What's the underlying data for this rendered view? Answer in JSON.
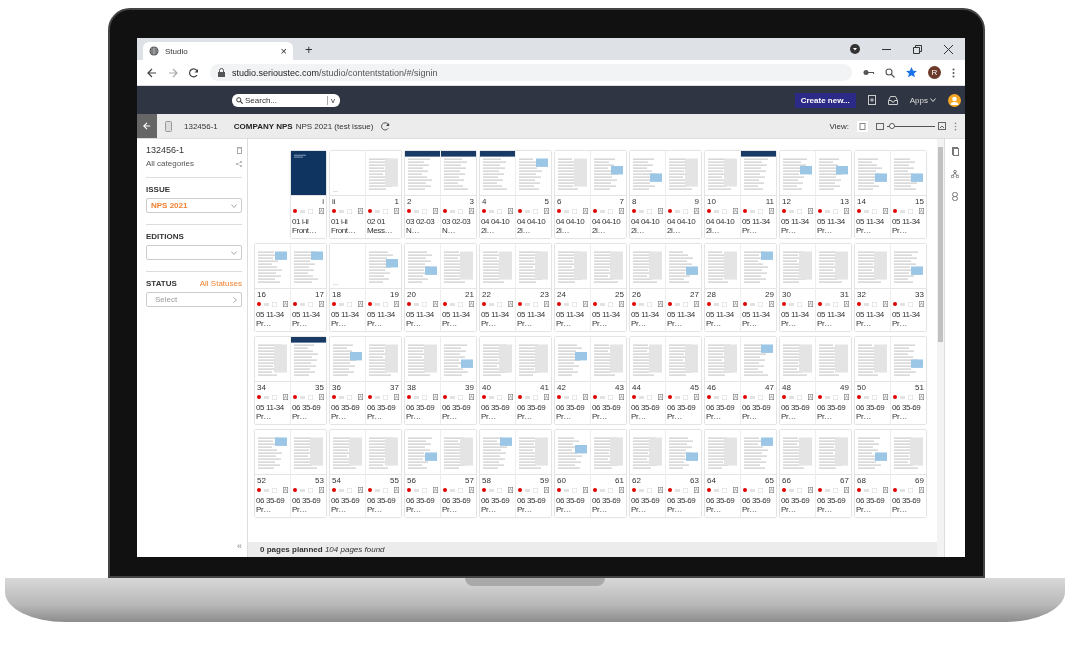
{
  "browser": {
    "tab": {
      "title": "Studio",
      "close": "×"
    },
    "new_tab": "+",
    "url_host": "studio.serioustec.com",
    "url_path": "/studio/contentstation/#/signin",
    "profile_initial": "R"
  },
  "header": {
    "search": {
      "placeholder": "Search...",
      "caret": "v"
    },
    "create_button": "Create new...",
    "apps_menu": "Apps"
  },
  "toolbar": {
    "id": "132456-1",
    "brand": "COMPANY NPS",
    "issue": "NPS 2021 (test issue)",
    "view_label": "View:",
    "zoom": {
      "level": 0.05
    }
  },
  "sidebar": {
    "title": "132456-1",
    "categories": "All categories",
    "issue_label": "ISSUE",
    "issue_value": "NPS 2021",
    "editions_label": "EDITIONS",
    "status_label": "STATUS",
    "status_link": "All Statuses",
    "status_select": {
      "placeholder": "Select"
    },
    "collapse": "«"
  },
  "spreads": [
    {
      "pages": [
        {
          "number": "i",
          "label": "01 i-ii Front…",
          "kind": "cover"
        }
      ]
    },
    {
      "pages": [
        {
          "number": "ii",
          "label": "01 i-ii Front…",
          "kind": "blank"
        },
        {
          "number": "1",
          "label": "02 01 Mess…",
          "kind": "text"
        }
      ]
    },
    {
      "pages": [
        {
          "number": "2",
          "label": "03 02-03 N…",
          "kind": "header"
        },
        {
          "number": "3",
          "label": "03 02-03 N…",
          "kind": "header"
        }
      ]
    },
    {
      "pages": [
        {
          "number": "4",
          "label": "04 04-10 2l…",
          "kind": "header"
        },
        {
          "number": "5",
          "label": "04 04-10 2l…",
          "kind": "figure"
        }
      ]
    },
    {
      "pages": [
        {
          "number": "6",
          "label": "04 04-10 2l…",
          "kind": "text"
        },
        {
          "number": "7",
          "label": "04 04-10 2l…",
          "kind": "figure"
        }
      ]
    },
    {
      "pages": [
        {
          "number": "8",
          "label": "04 04-10 2l…",
          "kind": "figure"
        },
        {
          "number": "9",
          "label": "04 04-10 2l…",
          "kind": "text"
        }
      ]
    },
    {
      "pages": [
        {
          "number": "10",
          "label": "04 04-10 2l…",
          "kind": "text"
        },
        {
          "number": "11",
          "label": "05 11-34 Pr…",
          "kind": "header"
        }
      ]
    },
    {
      "pages": [
        {
          "number": "12",
          "label": "05 11-34 Pr…",
          "kind": "figure"
        },
        {
          "number": "13",
          "label": "05 11-34 Pr…",
          "kind": "figure"
        }
      ]
    },
    {
      "pages": [
        {
          "number": "14",
          "label": "05 11-34 Pr…",
          "kind": "figure"
        },
        {
          "number": "15",
          "label": "05 11-34 Pr…",
          "kind": "figure"
        }
      ]
    },
    {
      "pages": [
        {
          "number": "16",
          "label": "05 11-34 Pr…",
          "kind": "figure"
        },
        {
          "number": "17",
          "label": "05 11-34 Pr…",
          "kind": "figure"
        }
      ]
    },
    {
      "pages": [
        {
          "number": "18",
          "label": "05 11-34 Pr…",
          "kind": "blank"
        },
        {
          "number": "19",
          "label": "05 11-34 Pr…",
          "kind": "figure"
        }
      ]
    },
    {
      "pages": [
        {
          "number": "20",
          "label": "05 11-34 Pr…",
          "kind": "figure"
        },
        {
          "number": "21",
          "label": "05 11-34 Pr…",
          "kind": "text"
        }
      ]
    },
    {
      "pages": [
        {
          "number": "22",
          "label": "05 11-34 Pr…",
          "kind": "text"
        },
        {
          "number": "23",
          "label": "05 11-34 Pr…",
          "kind": "text"
        }
      ]
    },
    {
      "pages": [
        {
          "number": "24",
          "label": "05 11-34 Pr…",
          "kind": "text"
        },
        {
          "number": "25",
          "label": "05 11-34 Pr…",
          "kind": "text"
        }
      ]
    },
    {
      "pages": [
        {
          "number": "26",
          "label": "05 11-34 Pr…",
          "kind": "text"
        },
        {
          "number": "27",
          "label": "05 11-34 Pr…",
          "kind": "figure"
        }
      ]
    },
    {
      "pages": [
        {
          "number": "28",
          "label": "05 11-34 Pr…",
          "kind": "text"
        },
        {
          "number": "29",
          "label": "05 11-34 Pr…",
          "kind": "figure"
        }
      ]
    },
    {
      "pages": [
        {
          "number": "30",
          "label": "05 11-34 Pr…",
          "kind": "text"
        },
        {
          "number": "31",
          "label": "05 11-34 Pr…",
          "kind": "text"
        }
      ]
    },
    {
      "pages": [
        {
          "number": "32",
          "label": "05 11-34 Pr…",
          "kind": "text"
        },
        {
          "number": "33",
          "label": "05 11-34 Pr…",
          "kind": "figure"
        }
      ]
    },
    {
      "pages": [
        {
          "number": "34",
          "label": "05 11-34 Pr…",
          "kind": "text"
        },
        {
          "number": "35",
          "label": "06 35-69 Pr…",
          "kind": "header"
        }
      ]
    },
    {
      "pages": [
        {
          "number": "36",
          "label": "06 35-69 Pr…",
          "kind": "figure"
        },
        {
          "number": "37",
          "label": "06 35-69 Pr…",
          "kind": "text"
        }
      ]
    },
    {
      "pages": [
        {
          "number": "38",
          "label": "06 35-69 Pr…",
          "kind": "text"
        },
        {
          "number": "39",
          "label": "06 35-69 Pr…",
          "kind": "figure"
        }
      ]
    },
    {
      "pages": [
        {
          "number": "40",
          "label": "06 35-69 Pr…",
          "kind": "text"
        },
        {
          "number": "41",
          "label": "06 35-69 Pr…",
          "kind": "text"
        }
      ]
    },
    {
      "pages": [
        {
          "number": "42",
          "label": "06 35-69 Pr…",
          "kind": "figure"
        },
        {
          "number": "43",
          "label": "06 35-69 Pr…",
          "kind": "text"
        }
      ]
    },
    {
      "pages": [
        {
          "number": "44",
          "label": "06 35-69 Pr…",
          "kind": "text"
        },
        {
          "number": "45",
          "label": "06 35-69 Pr…",
          "kind": "text"
        }
      ]
    },
    {
      "pages": [
        {
          "number": "46",
          "label": "06 35-69 Pr…",
          "kind": "text"
        },
        {
          "number": "47",
          "label": "06 35-69 Pr…",
          "kind": "figure"
        }
      ]
    },
    {
      "pages": [
        {
          "number": "48",
          "label": "06 35-69 Pr…",
          "kind": "text"
        },
        {
          "number": "49",
          "label": "06 35-69 Pr…",
          "kind": "text"
        }
      ]
    },
    {
      "pages": [
        {
          "number": "50",
          "label": "06 35-69 Pr…",
          "kind": "text"
        },
        {
          "number": "51",
          "label": "06 35-69 Pr…",
          "kind": "figure"
        }
      ]
    },
    {
      "pages": [
        {
          "number": "52",
          "label": "06 35-69 Pr…",
          "kind": "figure"
        },
        {
          "number": "53",
          "label": "06 35-69 Pr…",
          "kind": "text"
        }
      ]
    },
    {
      "pages": [
        {
          "number": "54",
          "label": "06 35-69 Pr…",
          "kind": "text"
        },
        {
          "number": "55",
          "label": "06 35-69 Pr…",
          "kind": "text"
        }
      ]
    },
    {
      "pages": [
        {
          "number": "56",
          "label": "06 35-69 Pr…",
          "kind": "figure"
        },
        {
          "number": "57",
          "label": "06 35-69 Pr…",
          "kind": "text"
        }
      ]
    },
    {
      "pages": [
        {
          "number": "58",
          "label": "06 35-69 Pr…",
          "kind": "figure"
        },
        {
          "number": "59",
          "label": "06 35-69 Pr…",
          "kind": "text"
        }
      ]
    },
    {
      "pages": [
        {
          "number": "60",
          "label": "06 35-69 Pr…",
          "kind": "figure"
        },
        {
          "number": "61",
          "label": "06 35-69 Pr…",
          "kind": "text"
        }
      ]
    },
    {
      "pages": [
        {
          "number": "62",
          "label": "06 35-69 Pr…",
          "kind": "text"
        },
        {
          "number": "63",
          "label": "06 35-69 Pr…",
          "kind": "figure"
        }
      ]
    },
    {
      "pages": [
        {
          "number": "64",
          "label": "06 35-69 Pr…",
          "kind": "text"
        },
        {
          "number": "65",
          "label": "06 35-69 Pr…",
          "kind": "figure"
        }
      ]
    },
    {
      "pages": [
        {
          "number": "66",
          "label": "06 35-69 Pr…",
          "kind": "text"
        },
        {
          "number": "67",
          "label": "06 35-69 Pr…",
          "kind": "text"
        }
      ]
    },
    {
      "pages": [
        {
          "number": "68",
          "label": "06 35-69 Pr…",
          "kind": "figure"
        },
        {
          "number": "69",
          "label": "06 35-69 Pr…",
          "kind": "text"
        }
      ]
    }
  ],
  "footer": "**0 pages planned** *104 pages found*"
}
